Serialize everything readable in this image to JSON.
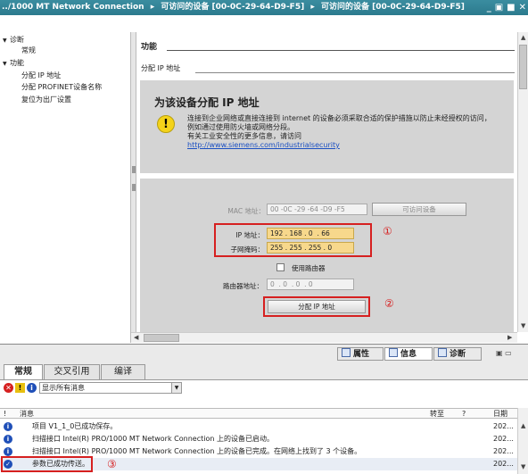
{
  "titlebar": {
    "crumbs": [
      "../1000 MT Network Connection",
      "可访问的设备 [00-0C-29-64-D9-F5]",
      "可访问的设备 [00-0C-29-64-D9-F5]"
    ],
    "separator": "▸",
    "controls": [
      "_",
      "▣",
      "■",
      "✕"
    ]
  },
  "nav": {
    "items": [
      {
        "label": "诊断",
        "expanded": true
      },
      {
        "label": "常规"
      },
      {
        "label": "功能",
        "expanded": true,
        "selected": true
      },
      {
        "label": "分配 IP 地址"
      },
      {
        "label": "分配 PROFINET设备名称"
      },
      {
        "label": "复位为出厂设置"
      }
    ],
    "arrow_expanded": "▼"
  },
  "main": {
    "section_title": "功能",
    "sub_title": "分配 IP 地址",
    "panel_title": "为该设备分配 IP 地址",
    "warning_icon": "!",
    "warning_text_1": "连接到企业网络或直接连接到 internet 的设备必须采取合适的保护措施以防止未经授权的访问，",
    "warning_text_2": "例如通过使用防火墙或网络分段。",
    "warning_text_3": "有关工业安全性的更多信息，请访问",
    "warning_link": "http://www.siemens.com/industrialsecurity",
    "mac_label": "MAC 地址：",
    "mac_value": "00 -0C -29 -64 -D9 -F5",
    "accessible_devices_button": "可访问设备",
    "ip_label": "IP 地址：",
    "ip_value": "192 . 168 . 0  . 66",
    "subnet_label": "子网掩码：",
    "subnet_value": "255 . 255 . 255 . 0",
    "use_router_label": "使用路由器",
    "router_label": "路由器地址：",
    "router_value": "0  . 0  . 0  . 0",
    "assign_button": "分配 IP 地址",
    "markers": [
      "①",
      "②",
      "③"
    ]
  },
  "inspector": {
    "tabs": [
      {
        "label": "属性",
        "icon": "properties-icon"
      },
      {
        "label": "信息",
        "icon": "info-icon"
      },
      {
        "label": "诊断",
        "icon": "diagnostics-icon"
      }
    ],
    "sub_tabs": [
      "常规",
      "交叉引用",
      "编译"
    ],
    "filter_value": "显示所有消息",
    "columns": {
      "mark": "!",
      "message": "消息",
      "goto": "转至",
      "question": "?",
      "date": "日期"
    },
    "messages": [
      {
        "icon": "info",
        "text": "项目 V1_1_0已成功保存。",
        "date": "202..."
      },
      {
        "icon": "info",
        "text": "扫描接口 Intel(R) PRO/1000 MT Network Connection 上的设备已启动。",
        "date": "202..."
      },
      {
        "icon": "info",
        "text": "扫描接口 Intel(R) PRO/1000 MT Network Connection 上的设备已完成。在网络上找到了 3 个设备。",
        "date": "202..."
      },
      {
        "icon": "ok",
        "text": "参数已成功传送。",
        "date": "202..."
      }
    ]
  },
  "colors": {
    "titlebar": "#2f8196",
    "highlight_box": "#d62020",
    "field_highlight": "#f7d88c",
    "panel_grey": "#d4d4d4"
  }
}
